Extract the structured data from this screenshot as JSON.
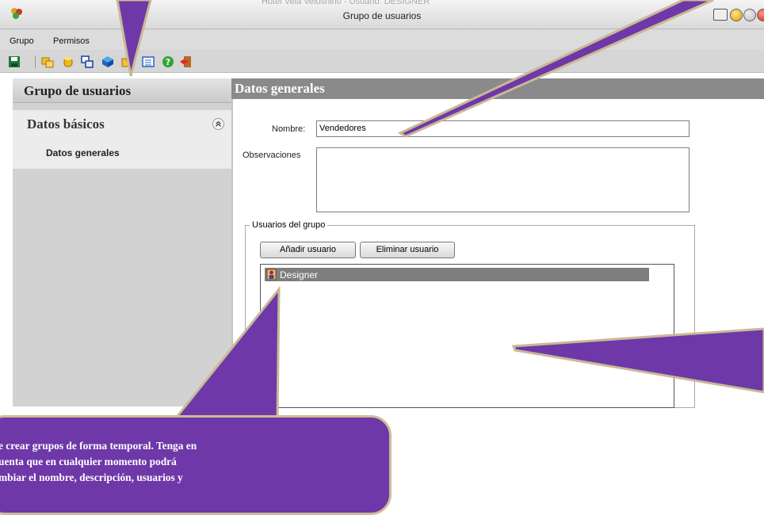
{
  "window": {
    "title": "Grupo de usuarios",
    "behind_title": "Hotel Vela Veloshino - Usuario: DESIGNER"
  },
  "menu": {
    "items": [
      "Grupo",
      "Permisos"
    ]
  },
  "toolbar": {
    "icons": [
      "save-icon",
      "users-group-icon",
      "database-icon",
      "copy-windows-icon",
      "cube-icon",
      "folder-icon",
      "calculator-icon",
      "help-icon",
      "exit-icon"
    ]
  },
  "sidebar": {
    "title": "Grupo de usuarios",
    "section": "Datos básicos",
    "items": [
      "Datos generales"
    ]
  },
  "content": {
    "header": "Datos generales",
    "nombre_label": "Nombre:",
    "nombre_value": "Vendedores",
    "observaciones_label": "Observaciones",
    "observaciones_value": "",
    "group_legend": "Usuarios del grupo",
    "add_button": "Añadir usuario",
    "remove_button": "Eliminar usuario",
    "users": [
      "Designer"
    ]
  },
  "tooltip": {
    "line1": "e crear grupos de forma temporal. Tenga en",
    "line2": "uenta que en cualquier momento podrá",
    "line3": "mbiar el nombre, descripción, usuarios y"
  },
  "colors": {
    "tutorial_purple": "#6e38a8",
    "selection_gray": "#7e7e7e",
    "header_gray": "#8a8a8a"
  }
}
